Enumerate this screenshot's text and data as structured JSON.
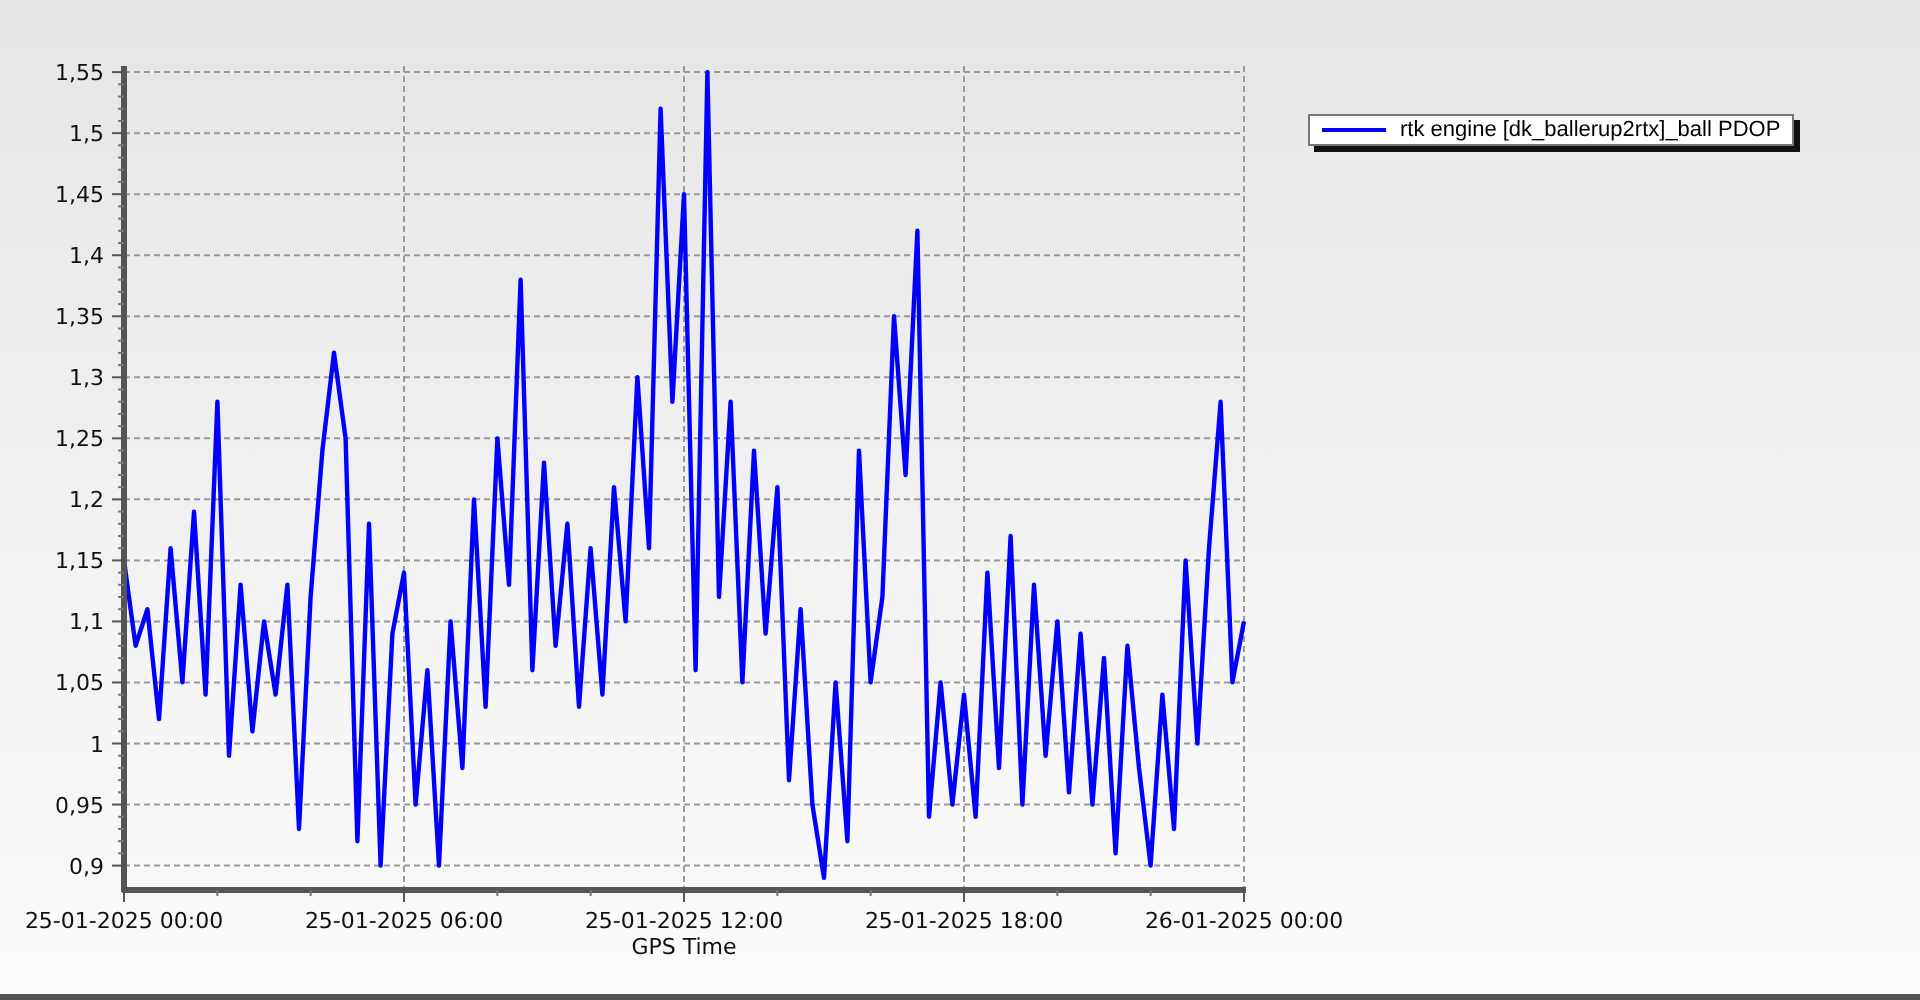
{
  "chart_data": {
    "type": "line",
    "grid": true,
    "xlabel": "GPS Time",
    "ylim": [
      0.88,
      1.555
    ],
    "categories": [
      "25-01-2025 00:00",
      null,
      null,
      null,
      null,
      null,
      null,
      null,
      null,
      null,
      null,
      null,
      null,
      null,
      null,
      null,
      null,
      null,
      null,
      null,
      null,
      null,
      null,
      null,
      "25-01-2025 06:00",
      null,
      null,
      null,
      null,
      null,
      null,
      null,
      null,
      null,
      null,
      null,
      null,
      null,
      null,
      null,
      null,
      null,
      null,
      null,
      null,
      null,
      null,
      null,
      "25-01-2025 12:00",
      null,
      null,
      null,
      null,
      null,
      null,
      null,
      null,
      null,
      null,
      null,
      null,
      null,
      null,
      null,
      null,
      null,
      null,
      null,
      null,
      null,
      null,
      null,
      "25-01-2025 18:00",
      null,
      null,
      null,
      null,
      null,
      null,
      null,
      null,
      null,
      null,
      null,
      null,
      null,
      null,
      null,
      null,
      null,
      null,
      null,
      null,
      null,
      null,
      null,
      "26-01-2025 00:00"
    ],
    "yticks": [
      {
        "value": 0.9,
        "label": "0,9"
      },
      {
        "value": 0.95,
        "label": "0,95"
      },
      {
        "value": 1,
        "label": "1"
      },
      {
        "value": 1.05,
        "label": "1,05"
      },
      {
        "value": 1.1,
        "label": "1,1"
      },
      {
        "value": 1.15,
        "label": "1,15"
      },
      {
        "value": 1.2,
        "label": "1,2"
      },
      {
        "value": 1.25,
        "label": "1,25"
      },
      {
        "value": 1.3,
        "label": "1,3"
      },
      {
        "value": 1.35,
        "label": "1,35"
      },
      {
        "value": 1.4,
        "label": "1,4"
      },
      {
        "value": 1.45,
        "label": "1,45"
      },
      {
        "value": 1.5,
        "label": "1,5"
      },
      {
        "value": 1.55,
        "label": "1,55"
      }
    ],
    "series": [
      {
        "name": "rtk engine [dk_ballerup2rtx]_ball PDOP",
        "color": "#0000ff",
        "values": [
          1.15,
          1.08,
          1.11,
          1.02,
          1.16,
          1.05,
          1.19,
          1.04,
          1.28,
          0.99,
          1.13,
          1.01,
          1.1,
          1.04,
          1.13,
          0.93,
          1.12,
          1.24,
          1.32,
          1.25,
          0.92,
          1.18,
          0.9,
          1.09,
          1.14,
          0.95,
          1.06,
          0.9,
          1.1,
          0.98,
          1.2,
          1.03,
          1.25,
          1.13,
          1.38,
          1.06,
          1.23,
          1.08,
          1.18,
          1.03,
          1.16,
          1.04,
          1.21,
          1.1,
          1.3,
          1.16,
          1.52,
          1.28,
          1.45,
          1.06,
          1.55,
          1.12,
          1.28,
          1.05,
          1.24,
          1.09,
          1.21,
          0.97,
          1.11,
          0.95,
          0.89,
          1.05,
          0.92,
          1.24,
          1.05,
          1.12,
          1.35,
          1.22,
          1.42,
          0.94,
          1.05,
          0.95,
          1.04,
          0.94,
          1.14,
          0.98,
          1.17,
          0.95,
          1.13,
          0.99,
          1.1,
          0.96,
          1.09,
          0.95,
          1.07,
          0.91,
          1.08,
          0.98,
          0.9,
          1.04,
          0.93,
          1.15,
          1.0,
          1.16,
          1.28,
          1.05,
          1.1
        ]
      }
    ]
  }
}
